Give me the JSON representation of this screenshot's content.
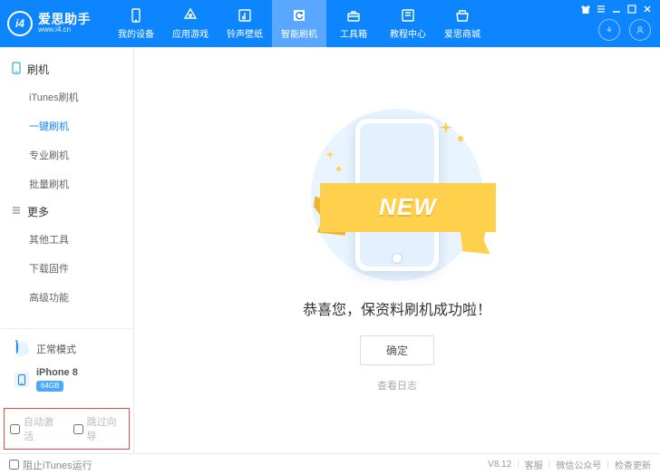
{
  "app": {
    "logo_text": "i4",
    "title": "爱思助手",
    "site": "www.i4.cn"
  },
  "nav": {
    "items": [
      {
        "label": "我的设备",
        "icon": "phone"
      },
      {
        "label": "应用游戏",
        "icon": "apps"
      },
      {
        "label": "铃声壁纸",
        "icon": "music"
      },
      {
        "label": "智能刷机",
        "icon": "refresh",
        "active": true
      },
      {
        "label": "工具箱",
        "icon": "toolbox"
      },
      {
        "label": "教程中心",
        "icon": "book"
      },
      {
        "label": "爱思商城",
        "icon": "store"
      }
    ]
  },
  "sidebar": {
    "groups": [
      {
        "head": "刷机",
        "icon": "device",
        "items": [
          "iTunes刷机",
          "一键刷机",
          "专业刷机",
          "批量刷机"
        ],
        "active_index": 1
      },
      {
        "head": "更多",
        "icon": "more",
        "items": [
          "其他工具",
          "下载固件",
          "高级功能"
        ],
        "active_index": -1
      }
    ],
    "mode_label": "正常模式",
    "device_name": "iPhone 8",
    "device_badge": "64GB",
    "chk_auto": "自动激活",
    "chk_skip": "跳过向导"
  },
  "main": {
    "ribbon": "NEW",
    "success": "恭喜您，保资料刷机成功啦！",
    "ok": "确定",
    "log": "查看日志"
  },
  "footer": {
    "block_itunes": "阻止iTunes运行",
    "version": "V8.12",
    "kefu": "客服",
    "wechat": "微信公众号",
    "update": "检查更新"
  }
}
